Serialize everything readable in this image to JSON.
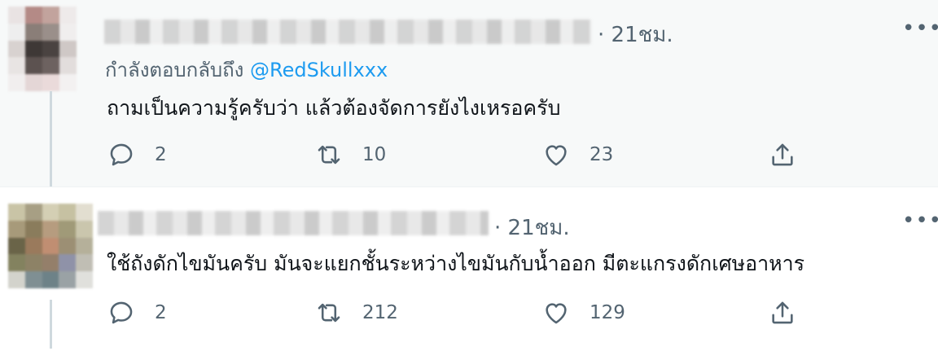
{
  "tweets": [
    {
      "time": "· 21ชม.",
      "more": "•••",
      "replying_to_prefix": "กำลังตอบกลับถึง ",
      "replying_to_handle": "@RedSkullxxx",
      "text": "ถามเป็นความรู้ครับว่า แล้วต้องจัดการยังไงเหรอครับ",
      "actions": {
        "reply": "2",
        "retweet": "10",
        "like": "23"
      }
    },
    {
      "time": "· 21ชม.",
      "more": "•••",
      "text": "ใช้ถังดักไขมันครับ มันจะแยกชั้นระหว่างไขมันกับน้ำออก มีตะแกรงดักเศษอาหาร",
      "actions": {
        "reply": "2",
        "retweet": "212",
        "like": "129"
      }
    }
  ],
  "icons": {
    "reply": "reply-bubble-icon",
    "retweet": "retweet-icon",
    "like": "heart-icon",
    "share": "share-icon",
    "more": "more-dots-icon"
  },
  "colors": {
    "text_primary": "#0f1419",
    "text_secondary": "#536471",
    "link": "#1d9bf0",
    "thread_line": "#cfd9de",
    "highlight_bg": "#f7f9f9"
  }
}
